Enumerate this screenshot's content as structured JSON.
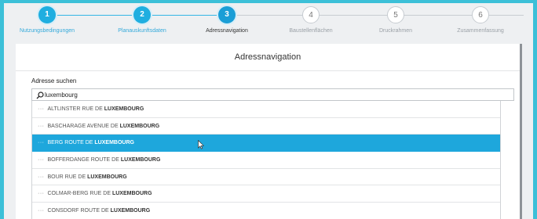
{
  "stepper": {
    "steps": [
      {
        "number": "1",
        "label": "Nutzungsbedingungen",
        "state": "done"
      },
      {
        "number": "2",
        "label": "Planauskunftsdaten",
        "state": "done"
      },
      {
        "number": "3",
        "label": "Adressnavigation",
        "state": "active"
      },
      {
        "number": "4",
        "label": "Baustellenflächen",
        "state": "todo"
      },
      {
        "number": "5",
        "label": "Druckrahmen",
        "state": "todo"
      },
      {
        "number": "6",
        "label": "Zusammenfassung",
        "state": "todo"
      }
    ]
  },
  "panel": {
    "title": "Adressnavigation",
    "search_label": "Adresse suchen",
    "search_value": "luxembourg",
    "search_icon": "search-icon"
  },
  "suggestions": [
    {
      "prefix": "ALTLINSTER RUE DE",
      "match": "LUXEMBOURG",
      "highlighted": false
    },
    {
      "prefix": "BASCHARAGE AVENUE DE",
      "match": "LUXEMBOURG",
      "highlighted": false
    },
    {
      "prefix": "BERG ROUTE DE",
      "match": "LUXEMBOURG",
      "highlighted": true
    },
    {
      "prefix": "BOFFERDANGE ROUTE DE",
      "match": "LUXEMBOURG",
      "highlighted": false
    },
    {
      "prefix": "BOUR RUE DE",
      "match": "LUXEMBOURG",
      "highlighted": false
    },
    {
      "prefix": "COLMAR-BERG RUE DE",
      "match": "LUXEMBOURG",
      "highlighted": false
    },
    {
      "prefix": "CONSDORF ROUTE DE",
      "match": "LUXEMBOURG",
      "highlighted": false
    }
  ],
  "suggestion_marker": "···",
  "colors": {
    "background": "#3cc0d8",
    "accent": "#1ea7dc",
    "done_step": "#1faee0"
  }
}
